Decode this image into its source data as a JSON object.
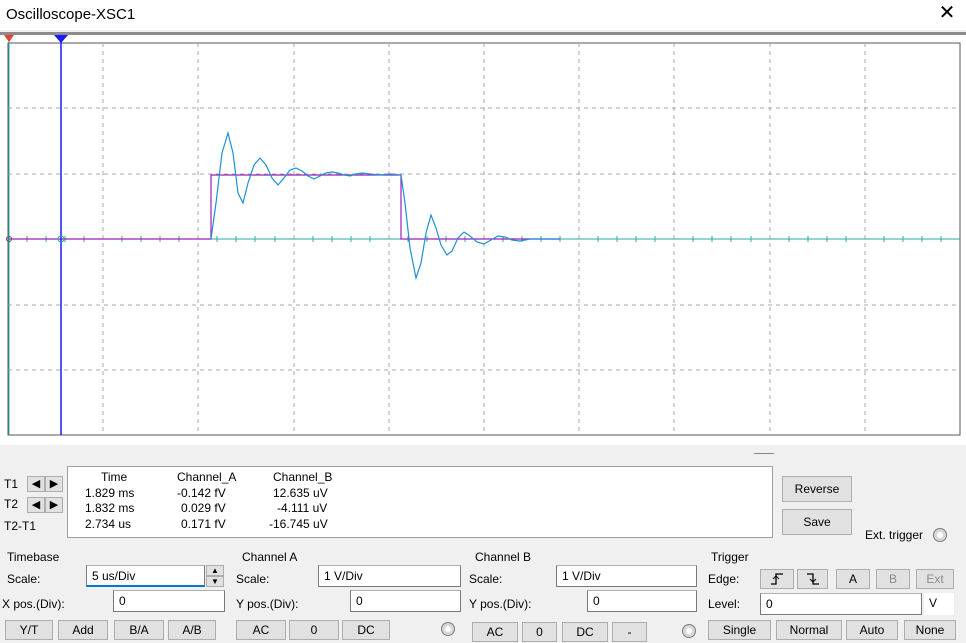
{
  "window": {
    "title": "Oscilloscope-XSC1",
    "close_icon": "close-icon"
  },
  "cursors": {
    "t1_marker": "T1",
    "t2_marker": "2"
  },
  "readout": {
    "headers": {
      "time": "Time",
      "channel_a": "Channel_A",
      "channel_b": "Channel_B"
    },
    "rows": [
      {
        "label": "T1",
        "time": "1.829 ms",
        "channel_a": "-0.142 fV",
        "channel_b": "12.635 uV"
      },
      {
        "label": "T2",
        "time": "1.832 ms",
        "channel_a": "0.029 fV",
        "channel_b": "-4.111 uV"
      },
      {
        "label": "T2-T1",
        "time": "2.734 us",
        "channel_a": "0.171 fV",
        "channel_b": "-16.745 uV"
      }
    ]
  },
  "buttons": {
    "reverse": "Reverse",
    "save": "Save",
    "ext_trigger": "Ext. trigger"
  },
  "timebase": {
    "title": "Timebase",
    "scale_label": "Scale:",
    "scale_value": "5 us/Div",
    "xpos_label": "X pos.(Div):",
    "xpos_value": "0",
    "modes": [
      "Y/T",
      "Add",
      "B/A",
      "A/B"
    ]
  },
  "channel_a": {
    "title": "Channel A",
    "scale_label": "Scale:",
    "scale_value": "1  V/Div",
    "ypos_label": "Y pos.(Div):",
    "ypos_value": "0",
    "coupling": [
      "AC",
      "0",
      "DC"
    ]
  },
  "channel_b": {
    "title": "Channel B",
    "scale_label": "Scale:",
    "scale_value": "1  V/Div",
    "ypos_label": "Y pos.(Div):",
    "ypos_value": "0",
    "coupling": [
      "AC",
      "0",
      "DC",
      "-"
    ]
  },
  "trigger": {
    "title": "Trigger",
    "edge_label": "Edge:",
    "edge_rising_icon": "rising-edge-icon",
    "edge_falling_icon": "falling-edge-icon",
    "sources": [
      "A",
      "B",
      "Ext"
    ],
    "level_label": "Level:",
    "level_value": "0",
    "level_unit": "V",
    "modes": [
      "Single",
      "Normal",
      "Auto",
      "None"
    ]
  },
  "colors": {
    "channel_a": "#9b1fb8",
    "channel_b": "#1f8fd6",
    "cursor_t2": "#1a1aff",
    "cursor_t1": "#e34234",
    "grid": "#a8a8a8",
    "axis": "#2aa8a8"
  }
}
